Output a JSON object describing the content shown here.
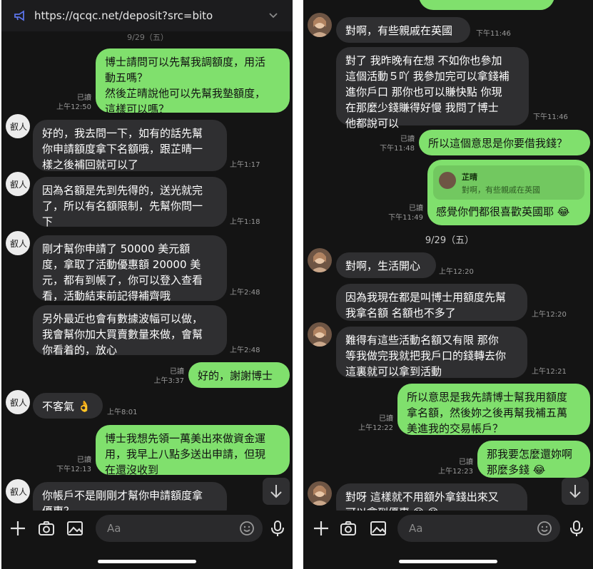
{
  "left": {
    "url": "https://qcqc.net/deposit?src=bito",
    "date_label": "9/29（五）",
    "messages": [
      {
        "text": "博士請問可以先幫我調額度，用活\n動五嗎？\n然後芷晴說他可以先幫我墊額度，\n這樣可以嗎？",
        "read": "已讀",
        "time": "上午12:50"
      },
      {
        "text": "好的，我去問一下，如有的話先幫\n你申請額度拿下名額哦，跟芷晴一\n樣之後補回就可以了",
        "time": "上午1:17"
      },
      {
        "text": "因為名額是先到先得的，送光就完\n了，所以有名額限制，先幫你問一\n下",
        "time": "上午1:18"
      },
      {
        "text": "剛才幫你申請了 50000 美元額\n度，拿取了活動優惠額 20000 美\n元，都有到帳了，你可以登入查看\n看，活動結束前記得補齊哦",
        "time": "上午2:48"
      },
      {
        "text": "另外最近也會有數據波幅可以做，\n我會幫你加大買賣數量來做，會幫\n你看着的，放心",
        "time": "上午2:48"
      },
      {
        "text": "好的，謝謝博士",
        "read": "已讀",
        "time": "上午3:37"
      },
      {
        "text": "不客氣 👌",
        "time": "上午8:01"
      },
      {
        "text": "博士我想先領一萬美出來做資金運\n用，我早上八點多送出申請，但現\n在還沒收到",
        "read": "已讀",
        "time": "下午12:13"
      },
      {
        "text": "你帳戶不是剛剛才幫你申請額度拿\n優惠？"
      }
    ]
  },
  "right": {
    "date_label": "9/29（五）",
    "messages": [
      {
        "text": "對啊，有些親戚在英國",
        "time": "下午11:46"
      },
      {
        "text": "對了 我昨晚有在想 不如你也參加\n這個活動５吖 我參加完可以拿錢補\n進你戶口 那你也可以賺快點 你現\n在那麼少錢賺得好慢 我問了博士\n他都說可以",
        "time": "下午11:46"
      },
      {
        "text": "所以這個意思是你要借我錢？",
        "read": "已讀",
        "time": "下午11:48"
      },
      {
        "quote_name": "芷晴",
        "quote_text": "對啊，有些親戚在英國",
        "text": "感覺你們都很喜歡英國耶 😂",
        "read": "已讀",
        "time": "下午11:49"
      },
      {
        "text": "對啊，生活開心",
        "time": "上午12:20"
      },
      {
        "text": "因為我現在都是叫博士用額度先幫\n我拿名額 名額也不多了",
        "time": "上午12:20"
      },
      {
        "text": "難得有這些活動名額又有限 那你\n等我做完我就把我戶口的錢轉去你\n這裏就可以拿到活動",
        "time": "上午12:21"
      },
      {
        "text": "所以意思是我先請博士幫我用額度\n拿名額，然後妳之後再幫我補五萬\n美進我的交易帳戶？",
        "read": "已讀",
        "time": "上午12:22"
      },
      {
        "text": "那我要怎麼還妳啊\n那麼多錢 😂",
        "read": "已讀",
        "time": "上午12:23"
      },
      {
        "text": "對呀 這樣就不用額外拿錢出來又\n可以拿到優惠 😊 😊"
      }
    ]
  },
  "input": {
    "placeholder": "Aa"
  },
  "colors": {
    "outgoing": "#80e06d",
    "incoming": "#2f2f31",
    "background": "#141414"
  },
  "icons": [
    "plus-icon",
    "camera-icon",
    "image-icon",
    "emoji-icon",
    "mic-icon",
    "arrow-down-icon",
    "megaphone-icon",
    "chevron-down-icon"
  ]
}
